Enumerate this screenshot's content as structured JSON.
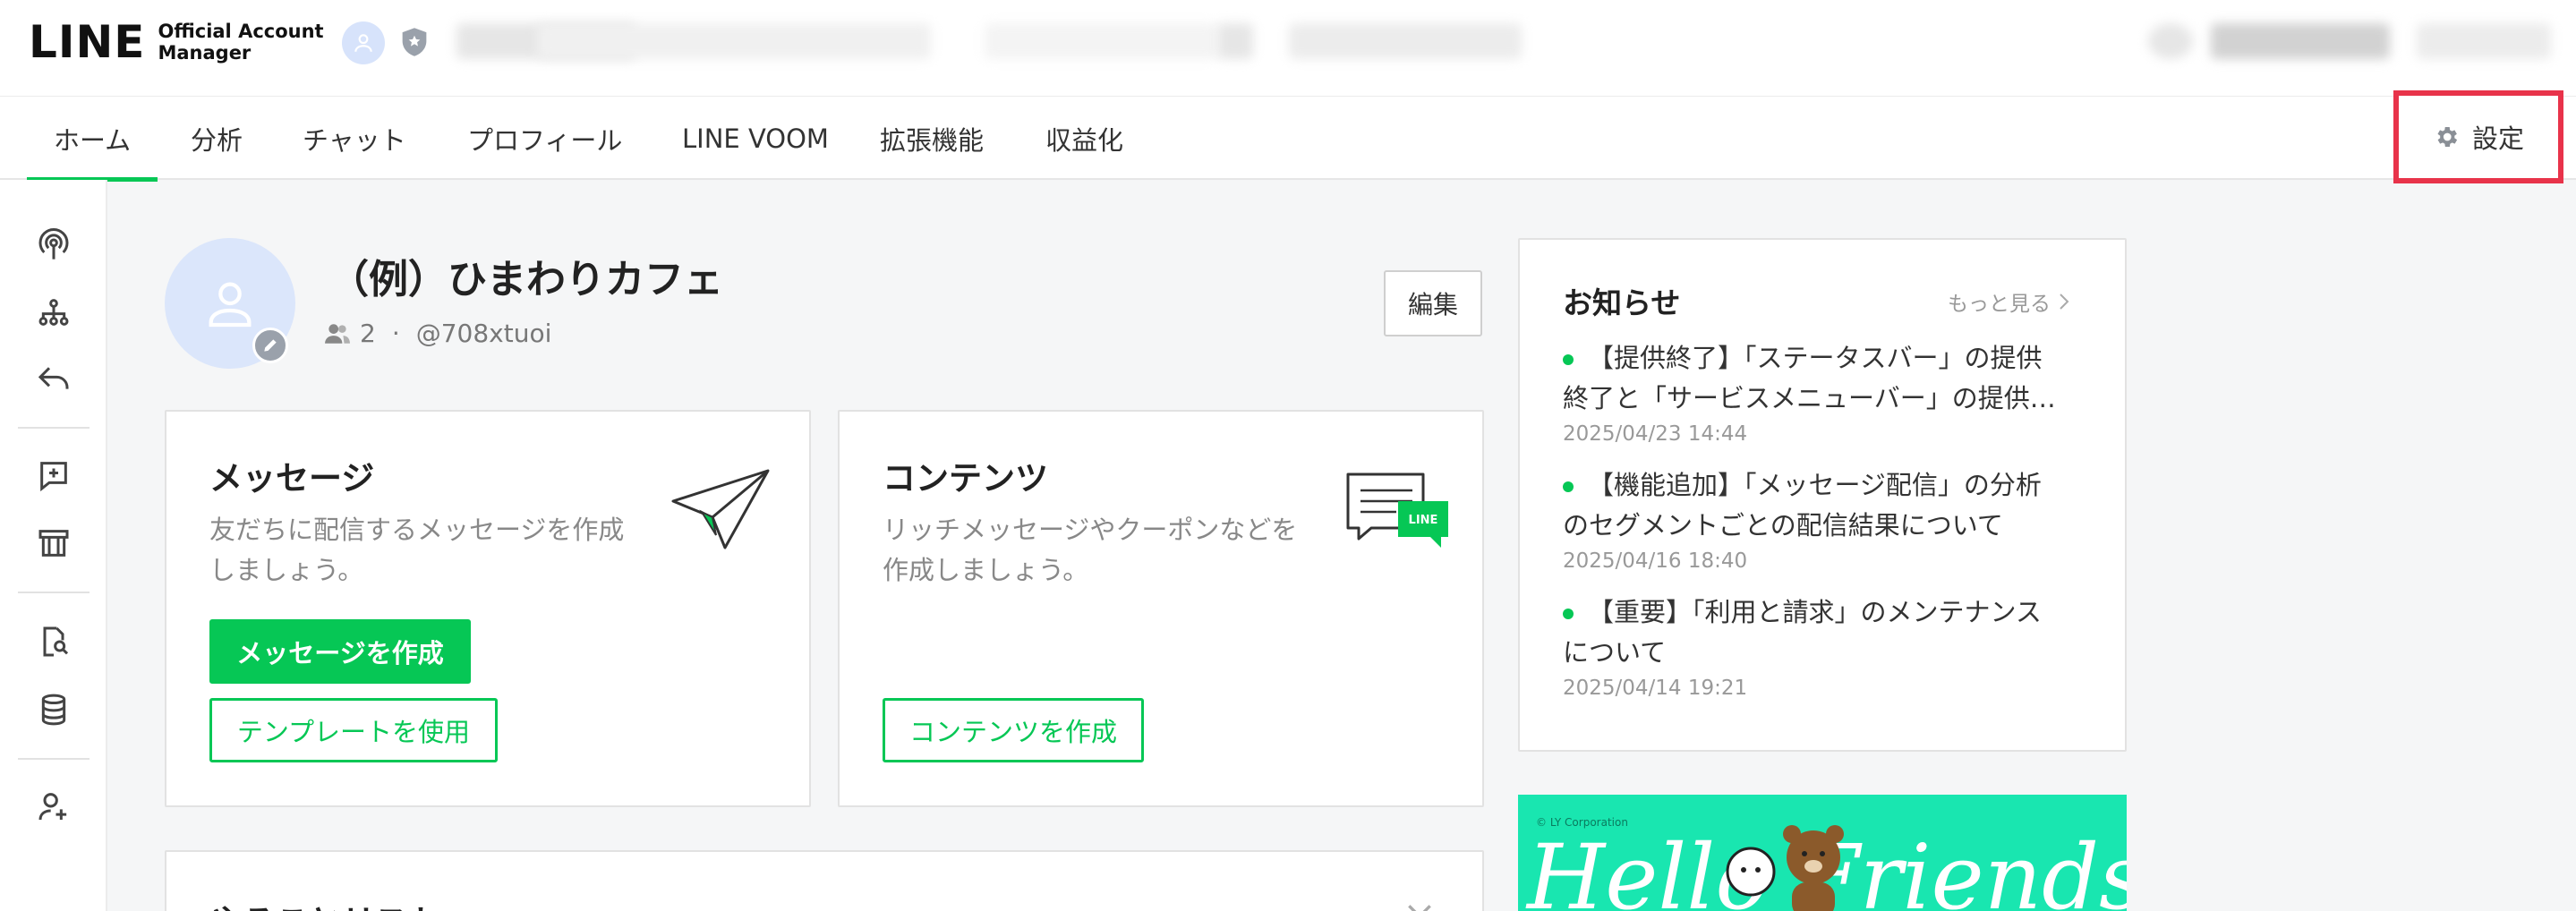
{
  "header": {
    "logo_main": "LINE",
    "logo_sub_line1": "Official Account",
    "logo_sub_line2": "Manager"
  },
  "nav": {
    "tabs": [
      {
        "label": "ホーム"
      },
      {
        "label": "分析"
      },
      {
        "label": "チャット"
      },
      {
        "label": "プロフィール"
      },
      {
        "label": "LINE VOOM"
      },
      {
        "label": "拡張機能"
      },
      {
        "label": "収益化"
      }
    ],
    "active_tab": "ホーム",
    "settings_label": "設定"
  },
  "profile": {
    "name": "（例）ひまわりカフェ",
    "friends_count": "2",
    "separator": "·",
    "account_id": "@708xtuoi",
    "edit_label": "編集"
  },
  "message_card": {
    "title": "メッセージ",
    "desc_line1": "友だちに配信するメッセージを作成",
    "desc_line2": "しましょう。",
    "primary_label": "メッセージを作成",
    "secondary_label": "テンプレートを使用"
  },
  "content_card": {
    "title": "コンテンツ",
    "desc_line1": "リッチメッセージやクーポンなどを",
    "desc_line2": "作成しましょう。",
    "button_label": "コンテンツを作成",
    "badge": "LINE"
  },
  "todo_card": {
    "title": "やることリスト"
  },
  "news": {
    "title": "お知らせ",
    "more_label": "もっと見る",
    "items": [
      {
        "line1": "【提供終了】「ステータスバー」の提供",
        "line2": "終了と「サービスメニューバー」の提供…",
        "date": "2025/04/23 14:44"
      },
      {
        "line1": "【機能追加】「メッセージ配信」の分析",
        "line2": "のセグメントごとの配信結果について",
        "date": "2025/04/16 18:40"
      },
      {
        "line1": "【重要】「利用と請求」のメンテナンス",
        "line2": "について",
        "date": "2025/04/14 19:21"
      }
    ]
  },
  "banner": {
    "copyright": "© LY Corporation",
    "text": "Hello Friends!"
  },
  "colors": {
    "brand_green": "#06c755",
    "highlight_red": "#e8334a"
  }
}
